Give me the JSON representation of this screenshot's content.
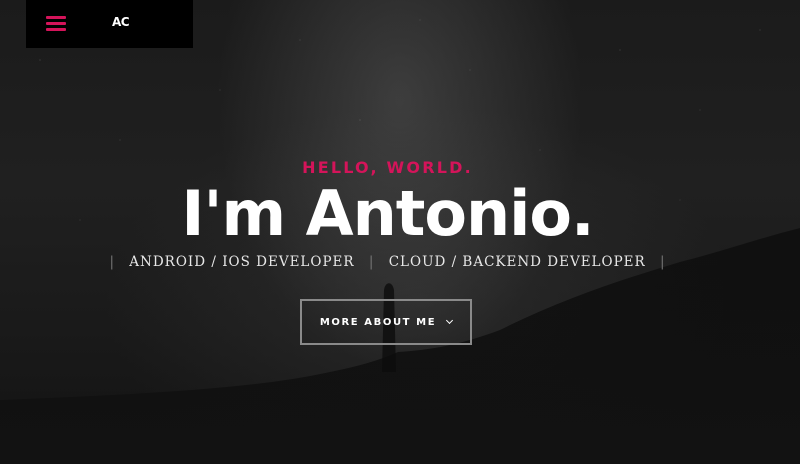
{
  "nav": {
    "logo": "AC",
    "menu_icon": "hamburger-menu-icon"
  },
  "hero": {
    "greeting": "HELLO, WORLD.",
    "title": "I'm Antonio.",
    "roles": [
      "ANDROID / IOS DEVELOPER",
      "CLOUD / BACKEND DEVELOPER"
    ],
    "cta_label": "MORE ABOUT ME",
    "cta_icon": "chevron-down-icon"
  },
  "colors": {
    "accent": "#d4145a",
    "background": "#1c1c1c",
    "text": "#ffffff"
  }
}
